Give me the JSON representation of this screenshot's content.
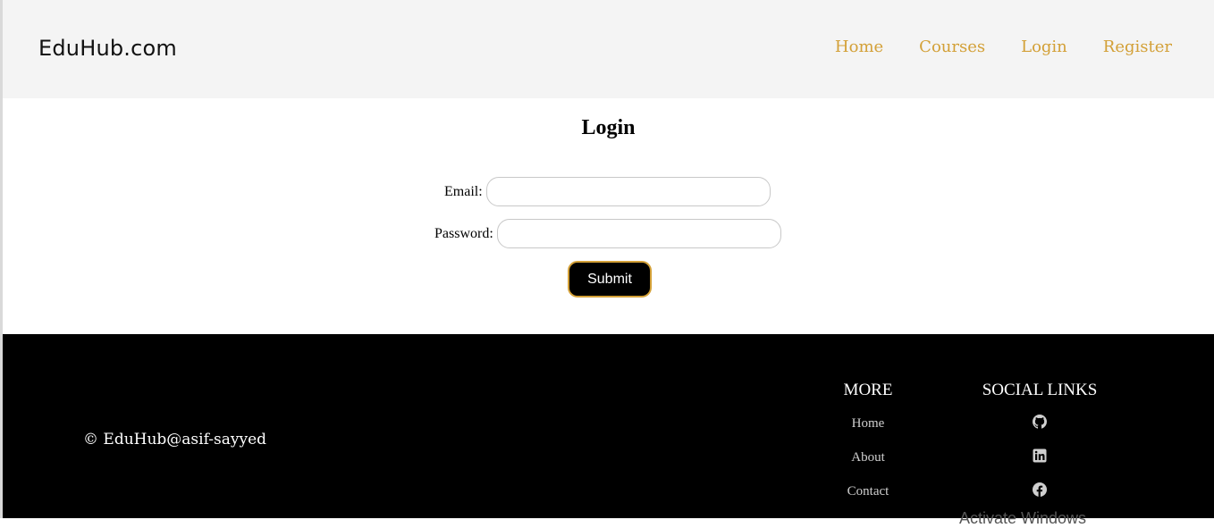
{
  "header": {
    "brand": "EduHub.com",
    "nav": [
      "Home",
      "Courses",
      "Login",
      "Register"
    ]
  },
  "login": {
    "title": "Login",
    "email_label": "Email:",
    "email_value": "",
    "password_label": "Password:",
    "password_value": "",
    "submit_label": "Submit"
  },
  "footer": {
    "copyright": "© EduHub@asif-sayyed",
    "more_title": "MORE",
    "more_links": [
      "Home",
      "About",
      "Contact"
    ],
    "social_title": "SOCIAL LINKS",
    "social_icons": [
      "github-icon",
      "linkedin-icon",
      "facebook-icon"
    ],
    "watermark": "Activate Windows"
  },
  "colors": {
    "accent": "#d3a037",
    "header_bg": "#f4f4f4",
    "footer_bg": "#000000"
  }
}
